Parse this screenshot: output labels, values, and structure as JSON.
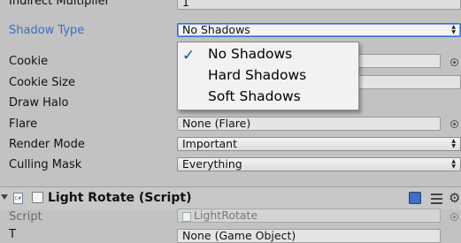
{
  "rows": {
    "indirect_multiplier": {
      "label": "Indirect Multiplier",
      "value": "1"
    },
    "shadow_type": {
      "label": "Shadow Type",
      "value": "No Shadows"
    },
    "cookie": {
      "label": "Cookie"
    },
    "cookie_size": {
      "label": "Cookie Size"
    },
    "draw_halo": {
      "label": "Draw Halo"
    },
    "flare": {
      "label": "Flare",
      "value": "None (Flare)"
    },
    "render_mode": {
      "label": "Render Mode",
      "value": "Important"
    },
    "culling_mask": {
      "label": "Culling Mask",
      "value": "Everything"
    }
  },
  "shadow_menu": {
    "options": [
      "No Shadows",
      "Hard Shadows",
      "Soft Shadows"
    ],
    "selected": "No Shadows",
    "check": "✓"
  },
  "component": {
    "title": "Light Rotate (Script)",
    "script_label": "Script",
    "script_value": "LightRotate",
    "icon_text": "C#",
    "next_label_partial": "T",
    "next_value_partial": "None (Game Object)"
  },
  "icons": {
    "arrow": "↕",
    "picker": "object-picker-icon",
    "gear": "⚙"
  }
}
